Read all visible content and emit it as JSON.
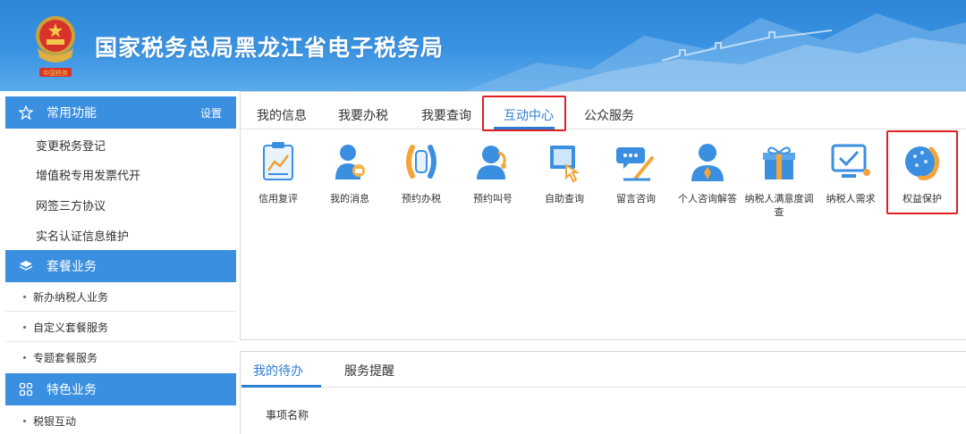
{
  "header": {
    "title": "国家税务总局黑龙江省电子税务局",
    "emblem_icon": "tax-emblem-icon"
  },
  "sidebar": {
    "common": {
      "label": "常用功能",
      "action": "设置",
      "icon": "star-icon",
      "items": [
        "变更税务登记",
        "增值税专用发票代开",
        "网签三方协议",
        "实名认证信息维护"
      ]
    },
    "package": {
      "label": "套餐业务",
      "icon": "layers-icon",
      "items": [
        "新办纳税人业务",
        "自定义套餐服务",
        "专题套餐服务"
      ]
    },
    "special": {
      "label": "特色业务",
      "icon": "grid-icon",
      "items": [
        "税银互动"
      ]
    }
  },
  "main": {
    "tabs": [
      "我的信息",
      "我要办税",
      "我要查询",
      "互动中心",
      "公众服务"
    ],
    "active_tab": "互动中心",
    "functions": [
      {
        "label": "信用复评",
        "icon": "credit-review-icon"
      },
      {
        "label": "我的消息",
        "icon": "my-message-icon"
      },
      {
        "label": "预约办税",
        "icon": "appointment-tax-icon"
      },
      {
        "label": "预约叫号",
        "icon": "appointment-call-icon"
      },
      {
        "label": "自助查询",
        "icon": "self-query-icon"
      },
      {
        "label": "留言咨询",
        "icon": "message-consult-icon"
      },
      {
        "label": "个人咨询解答",
        "icon": "personal-consult-icon"
      },
      {
        "label": "纳税人满意度调查",
        "icon": "satisfaction-survey-icon"
      },
      {
        "label": "纳税人需求",
        "icon": "taxpayer-demand-icon"
      },
      {
        "label": "权益保护",
        "icon": "rights-protection-icon"
      }
    ]
  },
  "bottom": {
    "tabs": [
      "我的待办",
      "服务提醒"
    ],
    "active_tab": "我的待办",
    "column_header": "事项名称"
  },
  "colors": {
    "primary": "#3b8fe0",
    "active_text": "#2a7fd4",
    "highlight_border": "#e02020"
  }
}
